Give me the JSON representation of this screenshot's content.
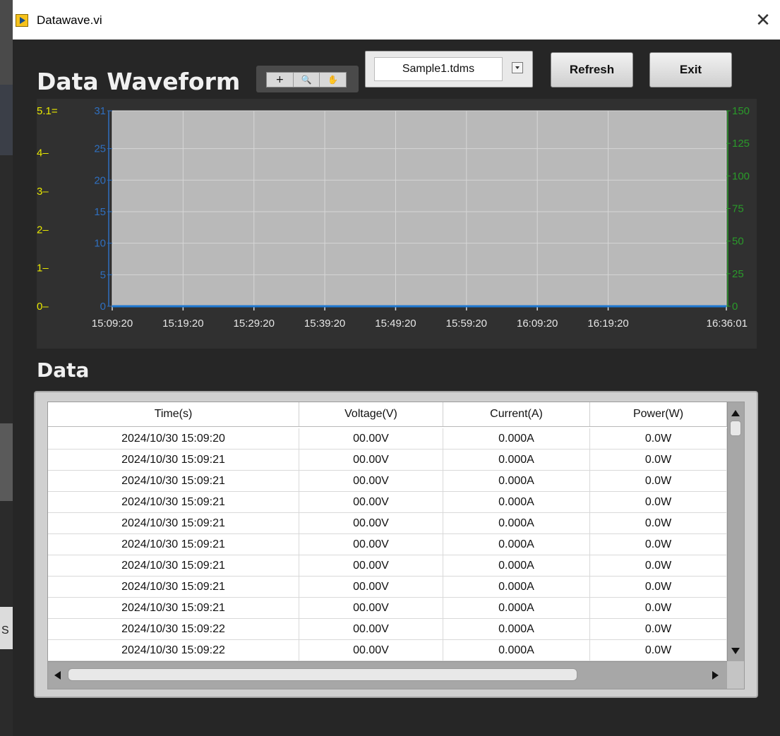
{
  "window": {
    "title": "Datawave.vi",
    "close_glyph": "✕",
    "icon": "labview-vi-icon"
  },
  "header": {
    "title": "Data Waveform",
    "graph_tools": [
      {
        "icon": "crosshair-cursor-icon",
        "glyph": "+"
      },
      {
        "icon": "zoom-icon",
        "glyph": "🔍"
      },
      {
        "icon": "pan-hand-icon",
        "glyph": "✋"
      }
    ],
    "file_select": {
      "value": "Sample1.tdms"
    },
    "refresh_label": "Refresh",
    "exit_label": "Exit"
  },
  "colors": {
    "panel_bg": "#262626",
    "plot_bg": "#b9b9b9",
    "axis_yellow": "#e8e800",
    "axis_blue": "#2f6fbf",
    "axis_green": "#2a9a2a",
    "trace_blue": "#1f78d1"
  },
  "chart_data": {
    "type": "line",
    "x_ticks": [
      "15:09:20",
      "15:19:20",
      "15:29:20",
      "15:39:20",
      "15:49:20",
      "15:59:20",
      "16:09:20",
      "16:19:20",
      "16:36:01"
    ],
    "y_axes": [
      {
        "side": "left-outer",
        "color": "#e8e800",
        "range": [
          0,
          5.1
        ],
        "ticks": [
          "5.1",
          "4",
          "3",
          "2",
          "1",
          "0"
        ]
      },
      {
        "side": "left-inner",
        "color": "#2f6fbf",
        "range": [
          0,
          31
        ],
        "ticks": [
          "31",
          "25",
          "20",
          "15",
          "10",
          "5",
          "0"
        ]
      },
      {
        "side": "right",
        "color": "#2a9a2a",
        "range": [
          0,
          150
        ],
        "ticks": [
          "150",
          "125",
          "100",
          "75",
          "50",
          "25",
          "0"
        ]
      }
    ],
    "series": [
      {
        "color": "#1f78d1",
        "values": [
          0,
          0,
          0,
          0,
          0,
          0,
          0,
          0,
          0
        ]
      }
    ],
    "grid": true
  },
  "data_section": {
    "title": "Data",
    "columns": [
      "Time(s)",
      "Voltage(V)",
      "Current(A)",
      "Power(W)"
    ],
    "rows": [
      [
        "2024/10/30 15:09:20",
        "00.00V",
        "0.000A",
        "0.0W"
      ],
      [
        "2024/10/30 15:09:21",
        "00.00V",
        "0.000A",
        "0.0W"
      ],
      [
        "2024/10/30 15:09:21",
        "00.00V",
        "0.000A",
        "0.0W"
      ],
      [
        "2024/10/30 15:09:21",
        "00.00V",
        "0.000A",
        "0.0W"
      ],
      [
        "2024/10/30 15:09:21",
        "00.00V",
        "0.000A",
        "0.0W"
      ],
      [
        "2024/10/30 15:09:21",
        "00.00V",
        "0.000A",
        "0.0W"
      ],
      [
        "2024/10/30 15:09:21",
        "00.00V",
        "0.000A",
        "0.0W"
      ],
      [
        "2024/10/30 15:09:21",
        "00.00V",
        "0.000A",
        "0.0W"
      ],
      [
        "2024/10/30 15:09:21",
        "00.00V",
        "0.000A",
        "0.0W"
      ],
      [
        "2024/10/30 15:09:22",
        "00.00V",
        "0.000A",
        "0.0W"
      ],
      [
        "2024/10/30 15:09:22",
        "00.00V",
        "0.000A",
        "0.0W"
      ]
    ]
  },
  "desktop": {
    "edge_label": "S"
  }
}
